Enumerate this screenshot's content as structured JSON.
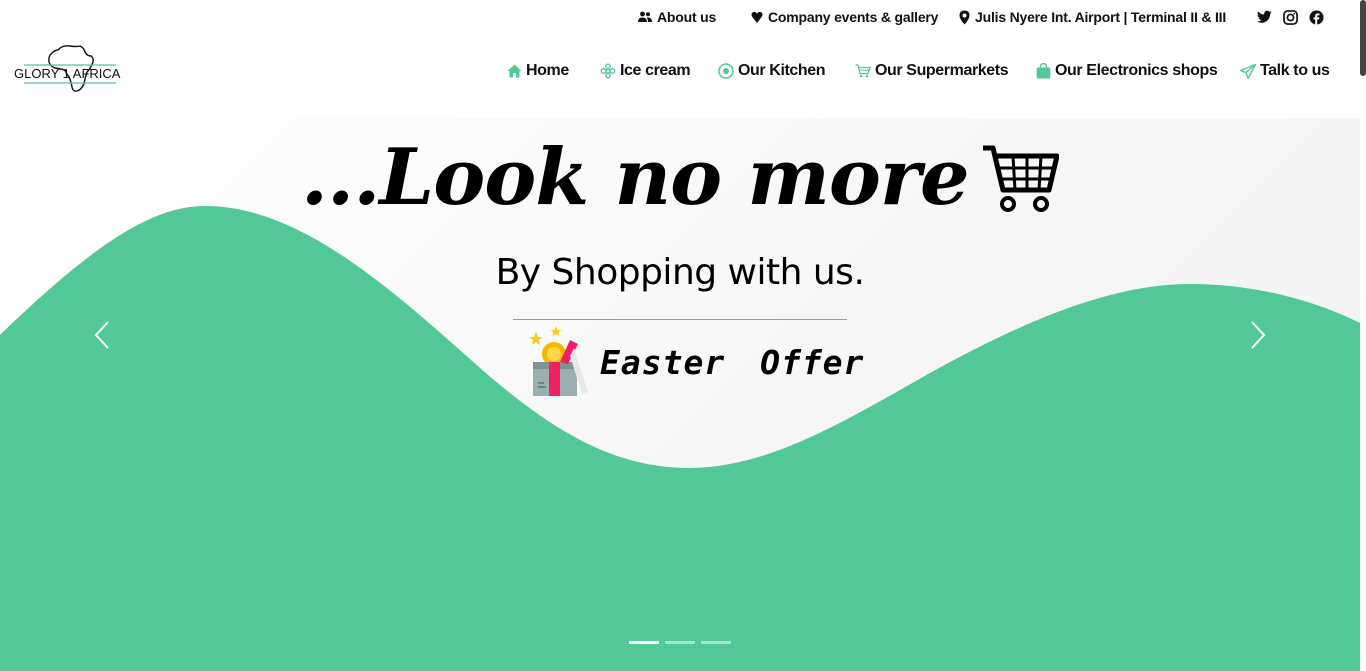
{
  "topbar": {
    "about": "About us",
    "events": "Company events & gallery",
    "location": "Julis Nyere Int. Airport | Terminal II & III"
  },
  "logo": {
    "text": "GLORY 1 AFRICA"
  },
  "nav": {
    "home": "Home",
    "icecream": "Ice cream",
    "kitchen": "Our Kitchen",
    "supermarkets": "Our Supermarkets",
    "electronics": "Our Electronics shops",
    "talk": "Talk to us"
  },
  "hero": {
    "title": "...Look no more",
    "subtitle": "By Shopping with us.",
    "offer": "Easter Offer",
    "slides": 3,
    "active_slide": 1
  },
  "colors": {
    "accent": "#52c896",
    "text": "#111111"
  },
  "icons": [
    "users-icon",
    "heart-icon",
    "map-pin-icon",
    "twitter-icon",
    "instagram-icon",
    "facebook-icon",
    "home-icon",
    "flower-icon",
    "kitchen-icon",
    "cart-icon",
    "bag-icon",
    "send-icon",
    "shopping-cart-icon",
    "gift-icon",
    "chevron-left-icon",
    "chevron-right-icon"
  ]
}
